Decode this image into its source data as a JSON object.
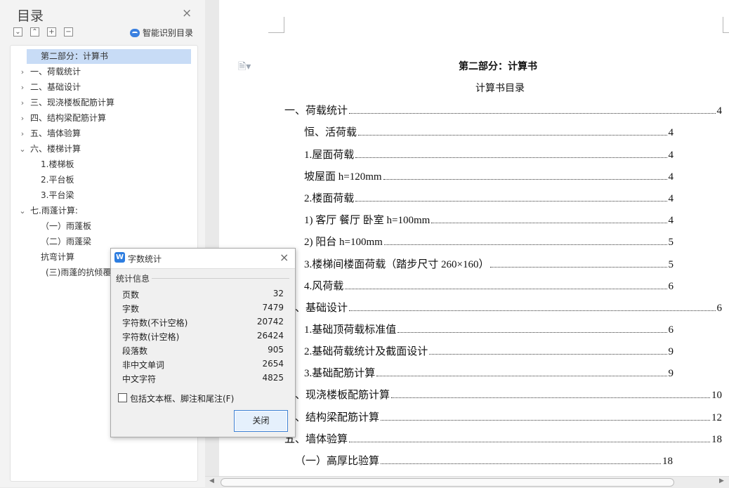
{
  "sidebar": {
    "title": "目录",
    "close": "×",
    "tools": [
      "⌄",
      "⌃",
      "+",
      "−"
    ],
    "smart_label": "智能识别目录",
    "items": [
      {
        "label": "第二部分：计算书",
        "arrow": ""
      },
      {
        "label": "一、荷载统计",
        "arrow": "›"
      },
      {
        "label": "二、基础设计",
        "arrow": "›"
      },
      {
        "label": "三、现浇楼板配筋计算",
        "arrow": "›"
      },
      {
        "label": "四、结构梁配筋计算",
        "arrow": "›"
      },
      {
        "label": "五、墙体验算",
        "arrow": "›"
      },
      {
        "label": "六、楼梯计算",
        "arrow": "⌄"
      },
      {
        "label": "1.楼梯板",
        "arrow": ""
      },
      {
        "label": "2.平台板",
        "arrow": ""
      },
      {
        "label": "3.平台梁",
        "arrow": ""
      },
      {
        "label": "七.雨蓬计算:",
        "arrow": "⌄"
      },
      {
        "label": "（一）雨蓬板",
        "arrow": ""
      },
      {
        "label": "（二）雨蓬梁",
        "arrow": ""
      },
      {
        "label": "抗弯计算",
        "arrow": ""
      },
      {
        "label": "(三)雨蓬的抗倾覆",
        "arrow": ""
      }
    ]
  },
  "document": {
    "heading": "第二部分：计算书",
    "subheading": "计算书目录",
    "toc": [
      {
        "text": "一、荷载统计",
        "page": "4"
      },
      {
        "text": "恒、活荷载",
        "page": "4"
      },
      {
        "text": "1.屋面荷载",
        "page": "4"
      },
      {
        "text": "坡屋面  h=120mm",
        "page": "4"
      },
      {
        "text": "2.楼面荷载",
        "page": "4"
      },
      {
        "text": "1)   客厅  餐厅  卧室  h=100mm",
        "page": "4"
      },
      {
        "text": "2)   阳台 h=100mm",
        "page": "5"
      },
      {
        "text": "3.楼梯间楼面荷载（踏步尺寸 260×160）",
        "page": "5"
      },
      {
        "text": "4.风荷载",
        "page": "6"
      },
      {
        "text": "二、基础设计",
        "page": "6"
      },
      {
        "text": "1.基础顶荷载标准值",
        "page": "6"
      },
      {
        "text": "2.基础荷载统计及截面设计",
        "page": "9"
      },
      {
        "text": "3.基础配筋计算",
        "page": "9"
      },
      {
        "text": "三、现浇楼板配筋计算",
        "page": "10"
      },
      {
        "text": "四、结构梁配筋计算",
        "page": "12"
      },
      {
        "text": "五、墙体验算",
        "page": "18"
      },
      {
        "text": "（一）高厚比验算",
        "page": "18"
      }
    ]
  },
  "dialog": {
    "title": "字数统计",
    "logo": "W",
    "close": "×",
    "group_label": "统计信息",
    "stats": [
      {
        "label": "页数",
        "value": "32"
      },
      {
        "label": "字数",
        "value": "7479"
      },
      {
        "label": "字符数(不计空格)",
        "value": "20742"
      },
      {
        "label": "字符数(计空格)",
        "value": "26424"
      },
      {
        "label": "段落数",
        "value": "905"
      },
      {
        "label": "非中文单词",
        "value": "2654"
      },
      {
        "label": "中文字符",
        "value": "4825"
      }
    ],
    "checkbox_label": "包括文本框、脚注和尾注(F)",
    "close_button": "关闭"
  }
}
